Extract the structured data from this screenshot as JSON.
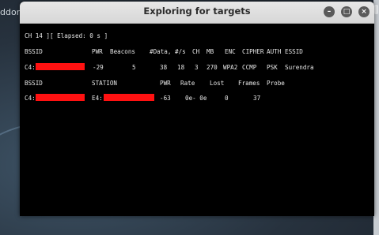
{
  "desktop": {
    "icon_label": "ddon"
  },
  "window": {
    "title": "Exploring for targets",
    "buttons": {
      "minimize": "–",
      "maximize": "□",
      "close": "×"
    }
  },
  "terminal": {
    "status_line": "CH 14 ][ Elapsed: 0 s ]",
    "ap_headers": [
      "BSSID",
      "PWR",
      "Beacons",
      "#Data,",
      "#/s",
      "CH",
      "MB",
      "ENC",
      "CIPHER",
      "AUTH",
      "ESSID"
    ],
    "ap_row": {
      "bssid_prefix": "C4:",
      "pwr": "-29",
      "beacons": "5",
      "data": "38",
      "per_sec": "18",
      "ch": "3",
      "mb": "270",
      "enc": "WPA2",
      "cipher": "CCMP",
      "auth": "PSK",
      "essid": "Surendra"
    },
    "client_headers": [
      "BSSID",
      "STATION",
      "PWR",
      "Rate",
      "Lost",
      "Frames",
      "Probe"
    ],
    "client_row": {
      "bssid_prefix": "C4:",
      "station_prefix": "E4:",
      "pwr": "-63",
      "rate": "0e- 0e",
      "lost": "0",
      "frames": "37"
    }
  },
  "colors": {
    "redaction": "#ff1111",
    "terminal_bg": "#000000",
    "terminal_text": "#e6e6e6"
  }
}
